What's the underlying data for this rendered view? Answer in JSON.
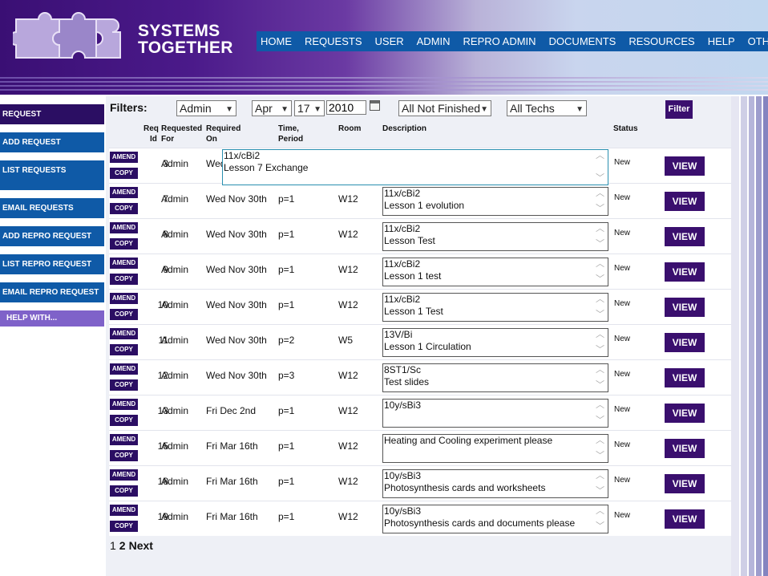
{
  "brand": {
    "line1": "SYSTEMS",
    "line2": "TOGETHER"
  },
  "colors": {
    "nav_blue": "#0f5aa7",
    "dark_purple": "#2b0e63",
    "button_purple": "#3a0f6e",
    "help_purple": "#7f62c9"
  },
  "topnav": [
    "HOME",
    "REQUESTS",
    "USER",
    "ADMIN",
    "REPRO ADMIN",
    "DOCUMENTS",
    "RESOURCES",
    "HELP",
    "OTHER"
  ],
  "sidebar": {
    "request": "REQUEST",
    "add_request": "ADD REQUEST",
    "list_requests": "LIST REQUESTS",
    "email_requests": "EMAIL REQUESTS",
    "add_repro": "ADD REPRO REQUEST",
    "list_repro": "LIST REPRO REQUEST",
    "email_repro": "EMAIL REPRO REQUEST",
    "help_with": "HELP WITH..."
  },
  "filters": {
    "label": "Filters:",
    "user": "Admin",
    "month": "Apr",
    "day": "17",
    "year": "2010",
    "status": "All Not Finished",
    "techs": "All Techs",
    "button": "Filter"
  },
  "columns": {
    "id_1": "Req",
    "id_2": "Id",
    "for_1": "Requested",
    "for_2": "For",
    "on_1": "Required",
    "on_2": "On",
    "time_1": "Time,",
    "time_2": "Period",
    "room": "Room",
    "description": "Description",
    "status": "Status"
  },
  "buttons": {
    "amend": "AMEND",
    "copy": "COPY",
    "view": "VIEW"
  },
  "rows": [
    {
      "id": "3",
      "for": "Admin",
      "required": "Wed",
      "time": "",
      "room": "",
      "desc1": "11x/cBi2",
      "desc2": "Lesson 7 Exchange",
      "status": "New"
    },
    {
      "id": "7",
      "for": "Admin",
      "required": "Wed Nov 30th",
      "time": "p=1",
      "room": "W12",
      "desc1": "11x/cBi2",
      "desc2": "Lesson 1 evolution",
      "status": "New"
    },
    {
      "id": "8",
      "for": "Admin",
      "required": "Wed Nov 30th",
      "time": "p=1",
      "room": "W12",
      "desc1": "11x/cBi2",
      "desc2": "Lesson Test",
      "status": "New"
    },
    {
      "id": "9",
      "for": "Admin",
      "required": "Wed Nov 30th",
      "time": "p=1",
      "room": "W12",
      "desc1": "11x/cBi2",
      "desc2": "Lesson 1 test",
      "status": "New"
    },
    {
      "id": "10",
      "for": "Admin",
      "required": "Wed Nov 30th",
      "time": "p=1",
      "room": "W12",
      "desc1": "11x/cBi2",
      "desc2": "Lesson 1 Test",
      "status": "New"
    },
    {
      "id": "11",
      "for": "Admin",
      "required": "Wed Nov 30th",
      "time": "p=2",
      "room": "W5",
      "desc1": "13V/Bi",
      "desc2": "Lesson 1 Circulation",
      "status": "New"
    },
    {
      "id": "12",
      "for": "Admin",
      "required": "Wed Nov 30th",
      "time": "p=3",
      "room": "W12",
      "desc1": "8ST1/Sc",
      "desc2": "Test slides",
      "status": "New"
    },
    {
      "id": "13",
      "for": "Admin",
      "required": "Fri Dec 2nd",
      "time": "p=1",
      "room": "W12",
      "desc1": "10y/sBi3",
      "desc2": "",
      "status": "New"
    },
    {
      "id": "15",
      "for": "Admin",
      "required": "Fri Mar 16th",
      "time": "p=1",
      "room": "W12",
      "desc1": "Heating and Cooling experiment please",
      "desc2": "",
      "status": "New"
    },
    {
      "id": "18",
      "for": "Admin",
      "required": "Fri Mar 16th",
      "time": "p=1",
      "room": "W12",
      "desc1": "10y/sBi3",
      "desc2": "Photosynthesis cards and worksheets",
      "status": "New"
    },
    {
      "id": "19",
      "for": "Admin",
      "required": "Fri Mar 16th",
      "time": "p=1",
      "room": "W12",
      "desc1": "10y/sBi3",
      "desc2": "Photosynthesis cards and documents please",
      "status": "New"
    }
  ],
  "pager": {
    "p1": "1",
    "p2": "2",
    "next": "Next"
  }
}
